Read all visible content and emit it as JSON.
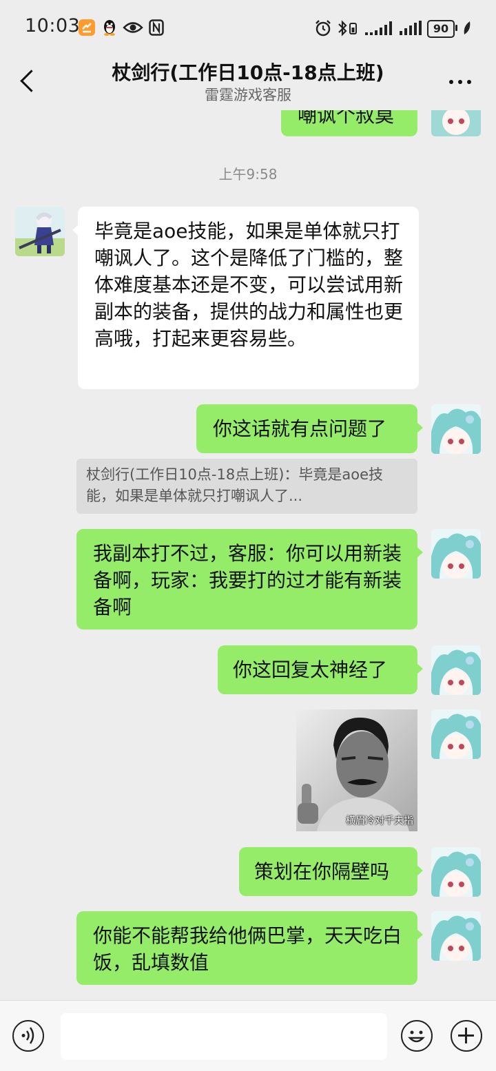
{
  "status_bar": {
    "time": "10:03",
    "battery": "90",
    "left_icons": [
      "app-badge-icon",
      "qq-penguin-icon",
      "eye-icon",
      "nfc-icon"
    ],
    "right_icons": [
      "alarm-icon",
      "bluetooth-icon",
      "signal-icon",
      "signal-icon",
      "battery-icon",
      "leaf-icon"
    ]
  },
  "header": {
    "title": "杖剑行(工作日10点-18点上班)",
    "subtitle": "雷霆游戏客服"
  },
  "messages": {
    "partial_top": "嘲讽个叔莫",
    "timestamp": "上午9:58",
    "m1": "毕竟是aoe技能，如果是单体就只打嘲讽人了。这个是降低了门槛的，整体难度基本还是不变，可以尝试用新副本的装备，提供的战力和属性也更高哦，打起来更容易些。",
    "m2": "你这话就有点问题了",
    "m2_quote": "杖剑行(工作日10点-18点上班)：毕竟是aoe技能，如果是单体就只打嘲讽人了...",
    "m3": "我副本打不过，客服：你可以用新装备啊，玩家：我要打的过才能有新装备啊",
    "m4": "你这回复太神经了",
    "m5_image_caption": "横眉冷对千夫指",
    "m6": "策划在你隔壁吗",
    "m7": "你能不能帮我给他俩巴掌，天天吃白饭，乱填数值"
  },
  "input": {
    "value": "",
    "placeholder": ""
  },
  "colors": {
    "background": "#ededed",
    "sent_bubble": "#95ec69",
    "received_bubble": "#ffffff",
    "status_badge": "#ff9b2f"
  }
}
